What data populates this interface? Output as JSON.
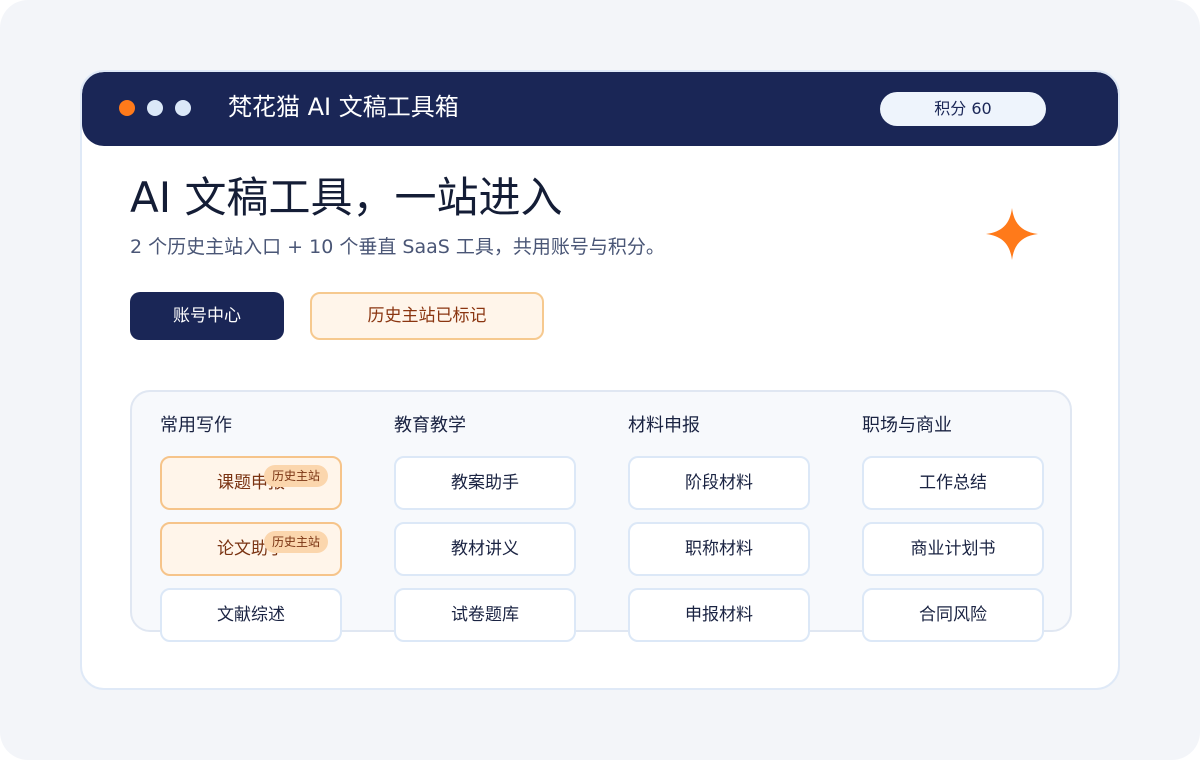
{
  "window": {
    "title": "梵花猫 AI 文稿工具箱",
    "points": "积分 60"
  },
  "hero": {
    "headline": "AI 文稿工具，一站进入",
    "subline": "2 个历史主站入口 + 10 个垂直 SaaS 工具，共用账号与积分。"
  },
  "actions": {
    "account_center": "账号中心",
    "legacy_marked": "历史主站已标记"
  },
  "badge_label": "历史主站",
  "categories": [
    {
      "title": "常用写作",
      "items": [
        {
          "label": "课题申报",
          "legacy": true
        },
        {
          "label": "论文助手",
          "legacy": true
        },
        {
          "label": "文献综述",
          "legacy": false
        }
      ]
    },
    {
      "title": "教育教学",
      "items": [
        {
          "label": "教案助手",
          "legacy": false
        },
        {
          "label": "教材讲义",
          "legacy": false
        },
        {
          "label": "试卷题库",
          "legacy": false
        }
      ]
    },
    {
      "title": "材料申报",
      "items": [
        {
          "label": "阶段材料",
          "legacy": false
        },
        {
          "label": "职称材料",
          "legacy": false
        },
        {
          "label": "申报材料",
          "legacy": false
        }
      ]
    },
    {
      "title": "职场与商业",
      "items": [
        {
          "label": "工作总结",
          "legacy": false
        },
        {
          "label": "商业计划书",
          "legacy": false
        },
        {
          "label": "合同风险",
          "legacy": false
        }
      ]
    }
  ],
  "colors": {
    "navy": "#1a2656",
    "accent_orange": "#ff7a1a",
    "legacy_bg": "#fff5ea",
    "legacy_border": "#f6c48a"
  },
  "icons": {
    "sparkle": "four-point-star-icon"
  }
}
